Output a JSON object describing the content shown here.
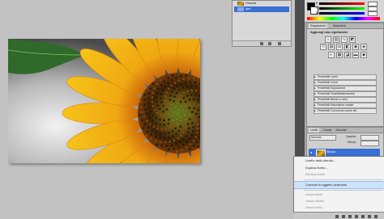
{
  "history": {
    "rows": [
      {
        "label": "Girasole",
        "selected": false
      },
      {
        "label": "Apri",
        "selected": true
      }
    ]
  },
  "colors": {
    "fg": "#000000",
    "bg": "#ffffff",
    "sliders": [
      {
        "label": "R",
        "gradient": "linear-gradient(90deg,#000,#f00)"
      },
      {
        "label": "G",
        "gradient": "linear-gradient(90deg,#000,#0f0)"
      },
      {
        "label": "B",
        "gradient": "linear-gradient(90deg,#000,#00f)"
      }
    ],
    "spectrum": "linear-gradient(90deg,#f00,#ff0,#0f0,#0ff,#00f,#f0f,#f00)"
  },
  "adjustments": {
    "tabs": [
      "Regolazioni",
      "Maschere"
    ],
    "title": "Aggiungi una regolazione",
    "presets": [
      "Predefiniti Livelli",
      "Predefiniti Curve",
      "Predefiniti Esposizione",
      "Predefiniti Tonalità/saturazione",
      "Predefiniti Bianco e nero",
      "Predefiniti Miscelatore canale",
      "Predefiniti Correzione colore sel..."
    ]
  },
  "layers": {
    "tabs": [
      "Livelli",
      "Canali",
      "Tracciati"
    ],
    "blend_mode": "Normale",
    "opacity_label": "Opacità:",
    "fill_label": "Riemp.:",
    "layer_name": "Sfondo"
  },
  "context_menu": {
    "items": [
      {
        "label": "Livello dallo sfondo...",
        "disabled": false,
        "highlight": false
      },
      {
        "label": "Duplica livello...",
        "disabled": false,
        "highlight": false
      },
      {
        "label": "Elimina livello",
        "disabled": true,
        "highlight": false
      },
      {
        "label": "Converti in oggetto avanzato",
        "disabled": false,
        "highlight": true
      },
      {
        "label": "Unisci livelli",
        "disabled": true,
        "highlight": false
      },
      {
        "label": "Unisci visibili",
        "disabled": true,
        "highlight": false
      },
      {
        "label": "Unico livello",
        "disabled": true,
        "highlight": false
      }
    ]
  }
}
